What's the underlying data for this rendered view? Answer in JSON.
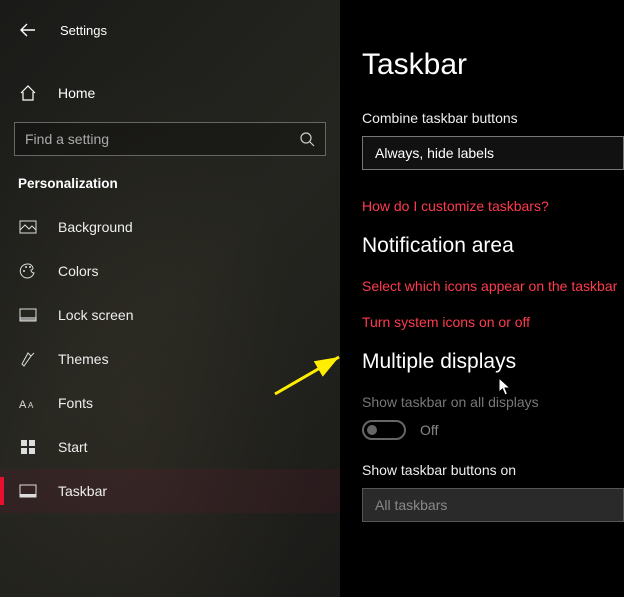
{
  "header": {
    "title": "Settings"
  },
  "home_label": "Home",
  "search": {
    "placeholder": "Find a setting"
  },
  "section_label": "Personalization",
  "nav": [
    {
      "label": "Background",
      "icon": "picture-icon"
    },
    {
      "label": "Colors",
      "icon": "palette-icon"
    },
    {
      "label": "Lock screen",
      "icon": "lockscreen-icon"
    },
    {
      "label": "Themes",
      "icon": "themes-icon"
    },
    {
      "label": "Fonts",
      "icon": "fonts-icon"
    },
    {
      "label": "Start",
      "icon": "start-icon"
    },
    {
      "label": "Taskbar",
      "icon": "taskbar-icon",
      "active": true
    }
  ],
  "main": {
    "title": "Taskbar",
    "combine_label": "Combine taskbar buttons",
    "combine_value": "Always, hide labels",
    "customize_link": "How do I customize taskbars?",
    "notification_h": "Notification area",
    "notif_link1": "Select which icons appear on the taskbar",
    "notif_link2": "Turn system icons on or off",
    "multi_h": "Multiple displays",
    "show_all_label": "Show taskbar on all displays",
    "toggle_state": "Off",
    "show_buttons_label": "Show taskbar buttons on",
    "show_buttons_value": "All taskbars"
  }
}
